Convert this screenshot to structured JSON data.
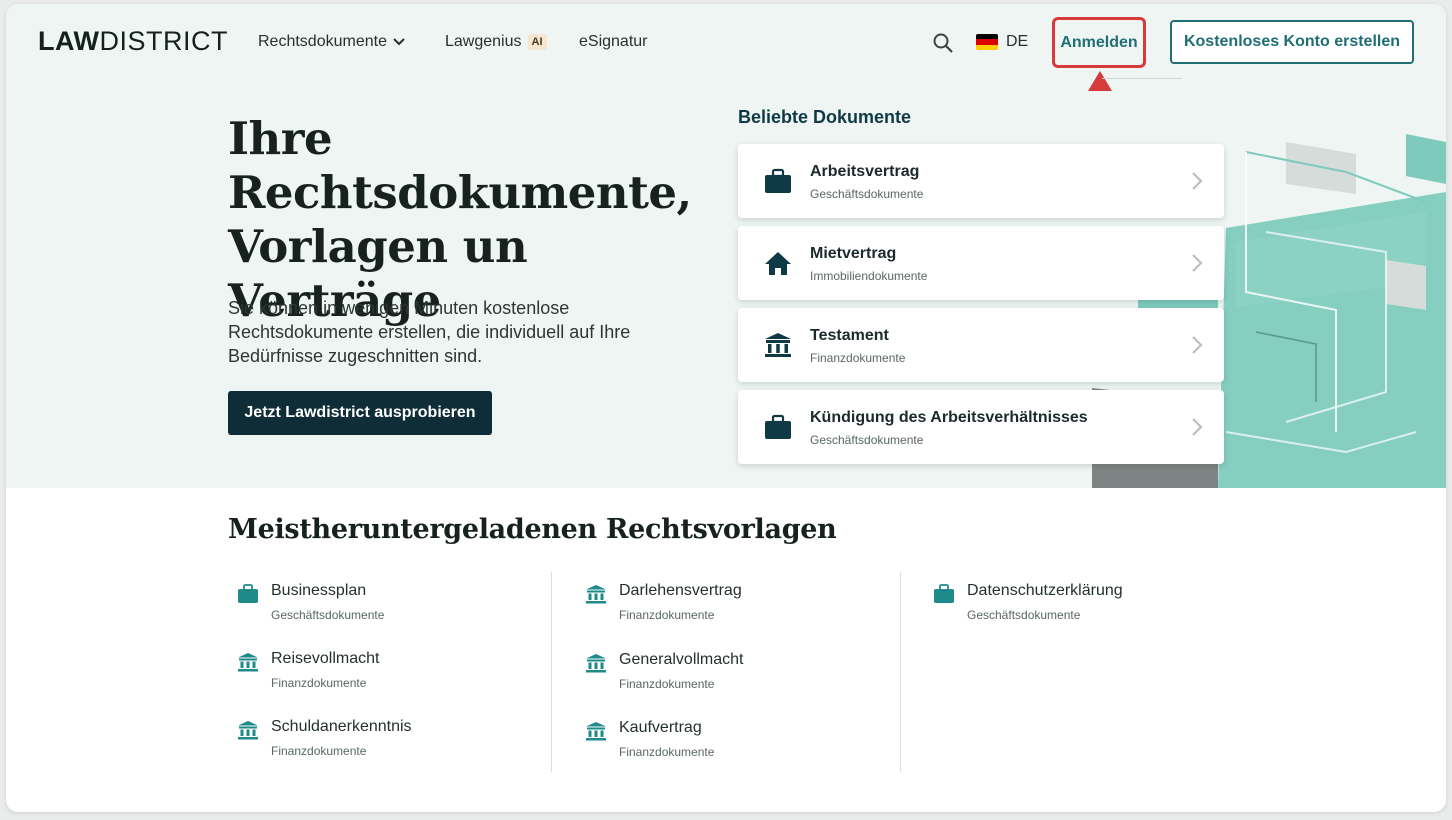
{
  "header": {
    "logo_bold": "LAW",
    "logo_regular": "DISTRICT",
    "nav": [
      {
        "label": "Rechtsdokumente",
        "icon": "chevron-down-icon"
      },
      {
        "label": "Lawgenius",
        "badge": "AI"
      },
      {
        "label": "eSignatur"
      }
    ],
    "search_icon": "search-icon",
    "language": "DE",
    "login_label": "Anmelden",
    "signup_label": "Kostenloses Konto erstellen"
  },
  "hero": {
    "title": "Ihre Rechtsdokumente, Vorlagen un Verträge",
    "subtitle": "Sie können in wenigen Minuten kostenlose Rechtsdokumente erstellen, die individuell auf Ihre Bedürfnisse zugeschnitten sind.",
    "cta_label": "Jetzt Lawdistrict ausprobieren"
  },
  "popular": {
    "title": "Beliebte Dokumente",
    "items": [
      {
        "name": "Arbeitsvertrag",
        "category": "Geschäftsdokumente",
        "icon": "briefcase-icon"
      },
      {
        "name": "Mietvertrag",
        "category": "Immobiliendokumente",
        "icon": "house-icon"
      },
      {
        "name": "Testament",
        "category": "Finanzdokumente",
        "icon": "bank-icon"
      },
      {
        "name": "Kündigung des Arbeitsverhältnisses",
        "category": "Geschäftsdokumente",
        "icon": "briefcase-icon"
      }
    ]
  },
  "most_downloaded": {
    "title": "Meistheruntergeladenen Rechtsvorlagen",
    "columns": [
      [
        {
          "name": "Businessplan",
          "category": "Geschäftsdokumente",
          "icon": "briefcase-icon"
        },
        {
          "name": "Reisevollmacht",
          "category": "Finanzdokumente",
          "icon": "bank-icon"
        },
        {
          "name": "Schuldanerkenntnis",
          "category": "Finanzdokumente",
          "icon": "bank-icon"
        }
      ],
      [
        {
          "name": "Darlehensvertrag",
          "category": "Finanzdokumente",
          "icon": "bank-icon"
        },
        {
          "name": "Generalvollmacht",
          "category": "Finanzdokumente",
          "icon": "bank-icon"
        },
        {
          "name": "Kaufvertrag",
          "category": "Finanzdokumente",
          "icon": "bank-icon"
        }
      ],
      [
        {
          "name": "Datenschutzerklärung",
          "category": "Geschäftsdokumente",
          "icon": "briefcase-icon"
        }
      ]
    ]
  },
  "colors": {
    "primary_dark": "#0f2d36",
    "teal": "#1f6f74",
    "accent_teal": "#7ecbbd",
    "highlight_red": "#d63a3a",
    "hero_bg": "#eef5f2"
  }
}
